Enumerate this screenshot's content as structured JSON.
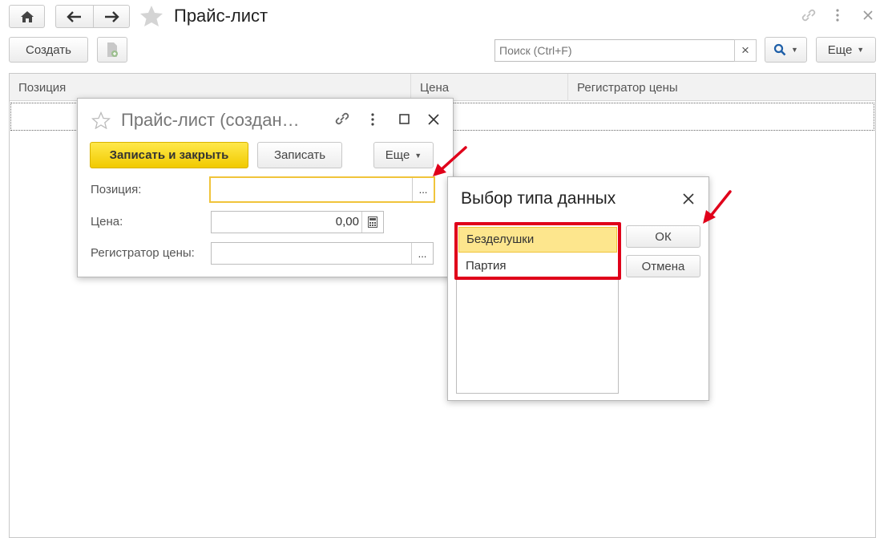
{
  "main": {
    "title": "Прайс-лист",
    "toolbar": {
      "create_label": "Создать",
      "search_placeholder": "Поиск (Ctrl+F)",
      "search_clear": "×",
      "more_label": "Еще"
    },
    "columns": [
      "Позиция",
      "Цена",
      "Регистратор цены"
    ]
  },
  "form": {
    "title": "Прайс-лист (создан…",
    "save_close_label": "Записать и закрыть",
    "save_label": "Записать",
    "more_label": "Еще",
    "fields": {
      "position_label": "Позиция:",
      "position_value": "",
      "price_label": "Цена:",
      "price_value": "0,00",
      "registrar_label": "Регистратор цены:",
      "registrar_value": ""
    },
    "select_button": "..."
  },
  "type_dialog": {
    "title": "Выбор типа данных",
    "items": [
      "Безделушки",
      "Партия"
    ],
    "selected_index": 0,
    "ok_label": "ОК",
    "cancel_label": "Отмена"
  },
  "colors": {
    "accent_yellow": "#f5d21a",
    "selection": "#fde68d",
    "highlight_red": "#e0001a",
    "link_blue": "#1e5fa8"
  },
  "icons": [
    "home-icon",
    "back-arrow-icon",
    "forward-arrow-icon",
    "star-icon",
    "link-icon",
    "more-vert-icon",
    "close-icon",
    "search-icon",
    "add-document-icon",
    "calculator-icon",
    "maximize-icon"
  ]
}
